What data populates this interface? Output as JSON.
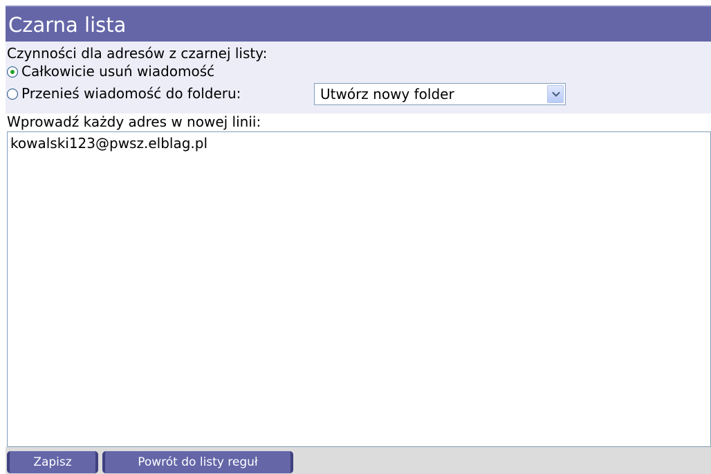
{
  "header": {
    "title": "Czarna lista"
  },
  "options": {
    "label": "Czynności dla adresów z czarnej listy:",
    "delete_label": "Całkowicie usuń wiadomość",
    "delete_checked": true,
    "move_label": "Przenieś wiadomość do folderu:",
    "move_checked": false,
    "folder_select": {
      "value": "Utwórz nowy folder",
      "icon": "chevron-down-icon"
    }
  },
  "addresses": {
    "label": "Wprowadź każdy adres w nowej linii:",
    "value": "kowalski123@pwsz.elblag.pl"
  },
  "footer": {
    "save_label": "Zapisz",
    "back_label": "Powrót do listy reguł"
  },
  "colors": {
    "header_bg": "#6466a8",
    "options_bg": "#ededf8",
    "footer_bg": "#dcdcdc",
    "button_bg": "#6466a8",
    "radio_selected": "#21a121"
  }
}
